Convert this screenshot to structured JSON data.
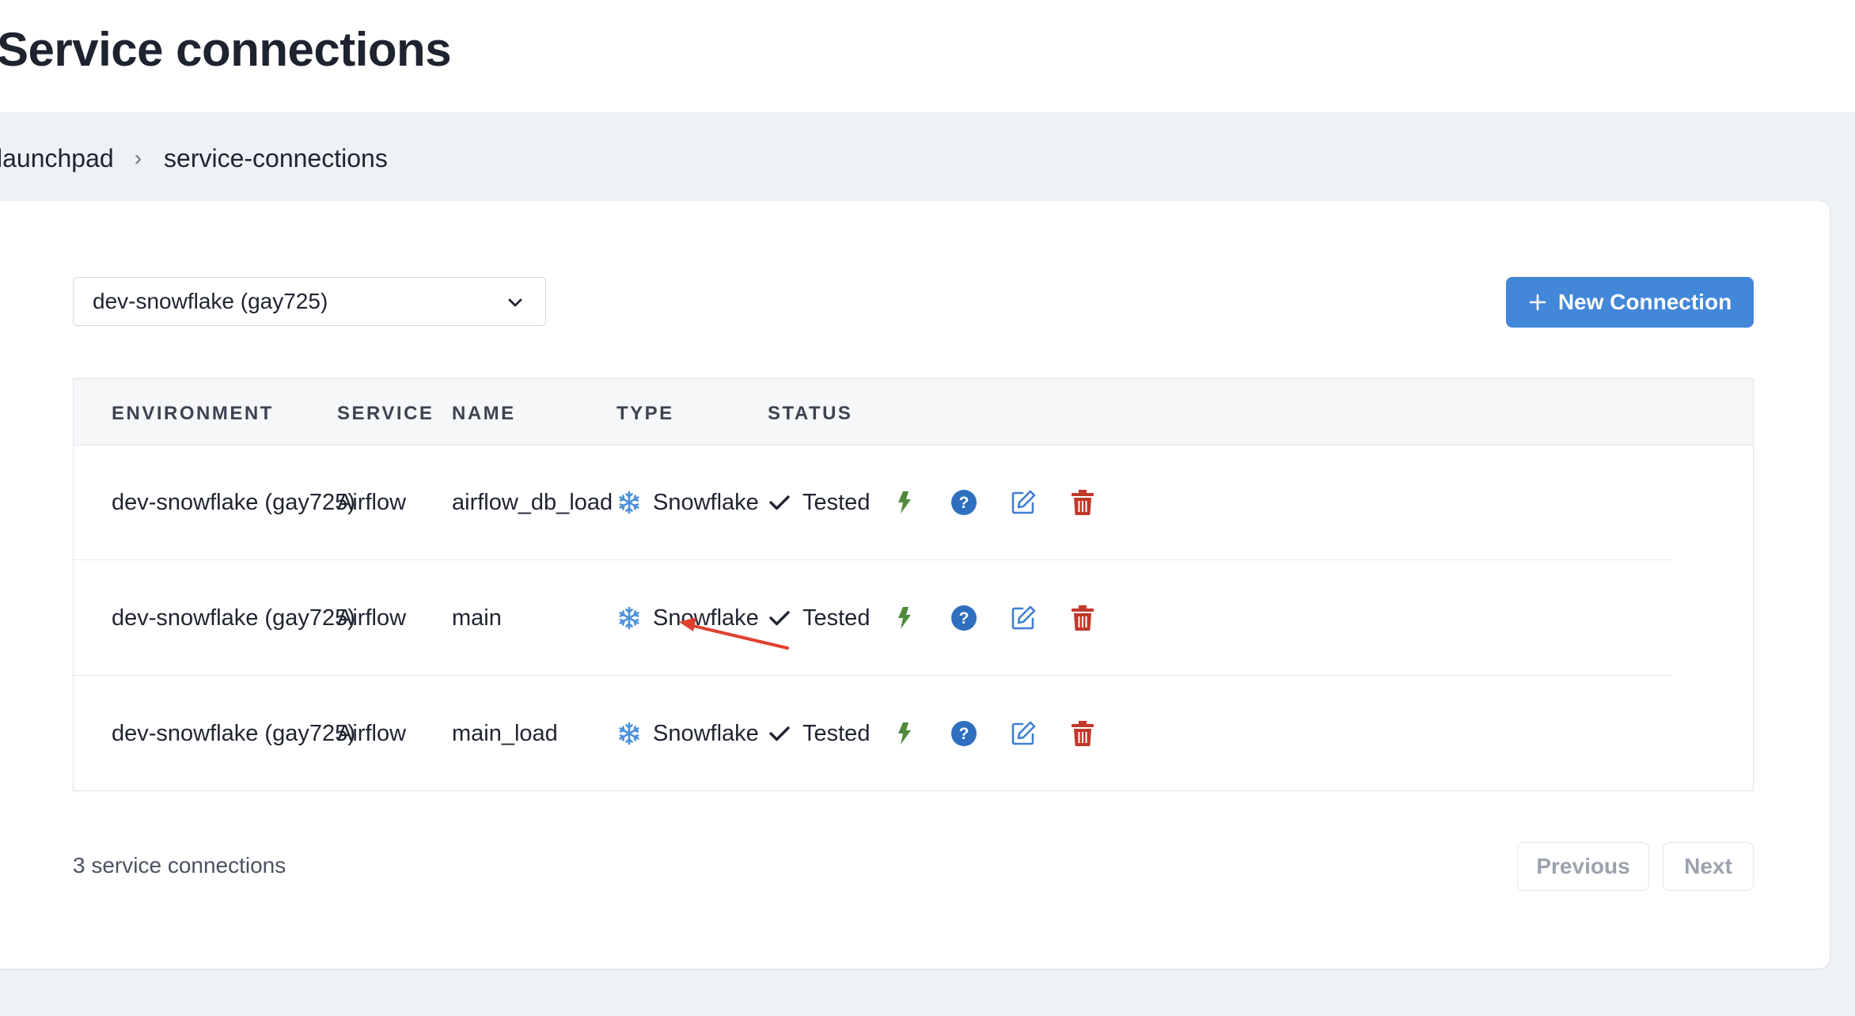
{
  "page_title": "Service connections",
  "breadcrumb": {
    "items": [
      "launchpad",
      "service-connections"
    ],
    "separator": "›"
  },
  "environment_select": {
    "value": "dev-snowflake (gay725)",
    "icon": "chevron-down-icon"
  },
  "new_button": {
    "label": "New Connection",
    "icon": "plus-icon",
    "color": "#4287d8"
  },
  "table": {
    "columns": [
      "ENVIRONMENT",
      "SERVICE",
      "NAME",
      "TYPE",
      "STATUS"
    ],
    "rows": [
      {
        "environment": "dev-snowflake (gay725)",
        "service": "Airflow",
        "name": "airflow_db_load",
        "type": "Snowflake",
        "status": "Tested"
      },
      {
        "environment": "dev-snowflake (gay725)",
        "service": "Airflow",
        "name": "main",
        "type": "Snowflake",
        "status": "Tested"
      },
      {
        "environment": "dev-snowflake (gay725)",
        "service": "Airflow",
        "name": "main_load",
        "type": "Snowflake",
        "status": "Tested"
      }
    ],
    "row_actions": [
      "bolt-icon",
      "help-icon",
      "edit-icon",
      "trash-icon"
    ]
  },
  "footer": {
    "count_text": "3 service connections",
    "previous_label": "Previous",
    "next_label": "Next"
  },
  "colors": {
    "bolt": "#4f8a3a",
    "help": "#2f6fbf",
    "edit": "#3f7fd0",
    "trash": "#c0392b",
    "snowflake": "#4a90d9",
    "annotation": "#e0412e"
  }
}
